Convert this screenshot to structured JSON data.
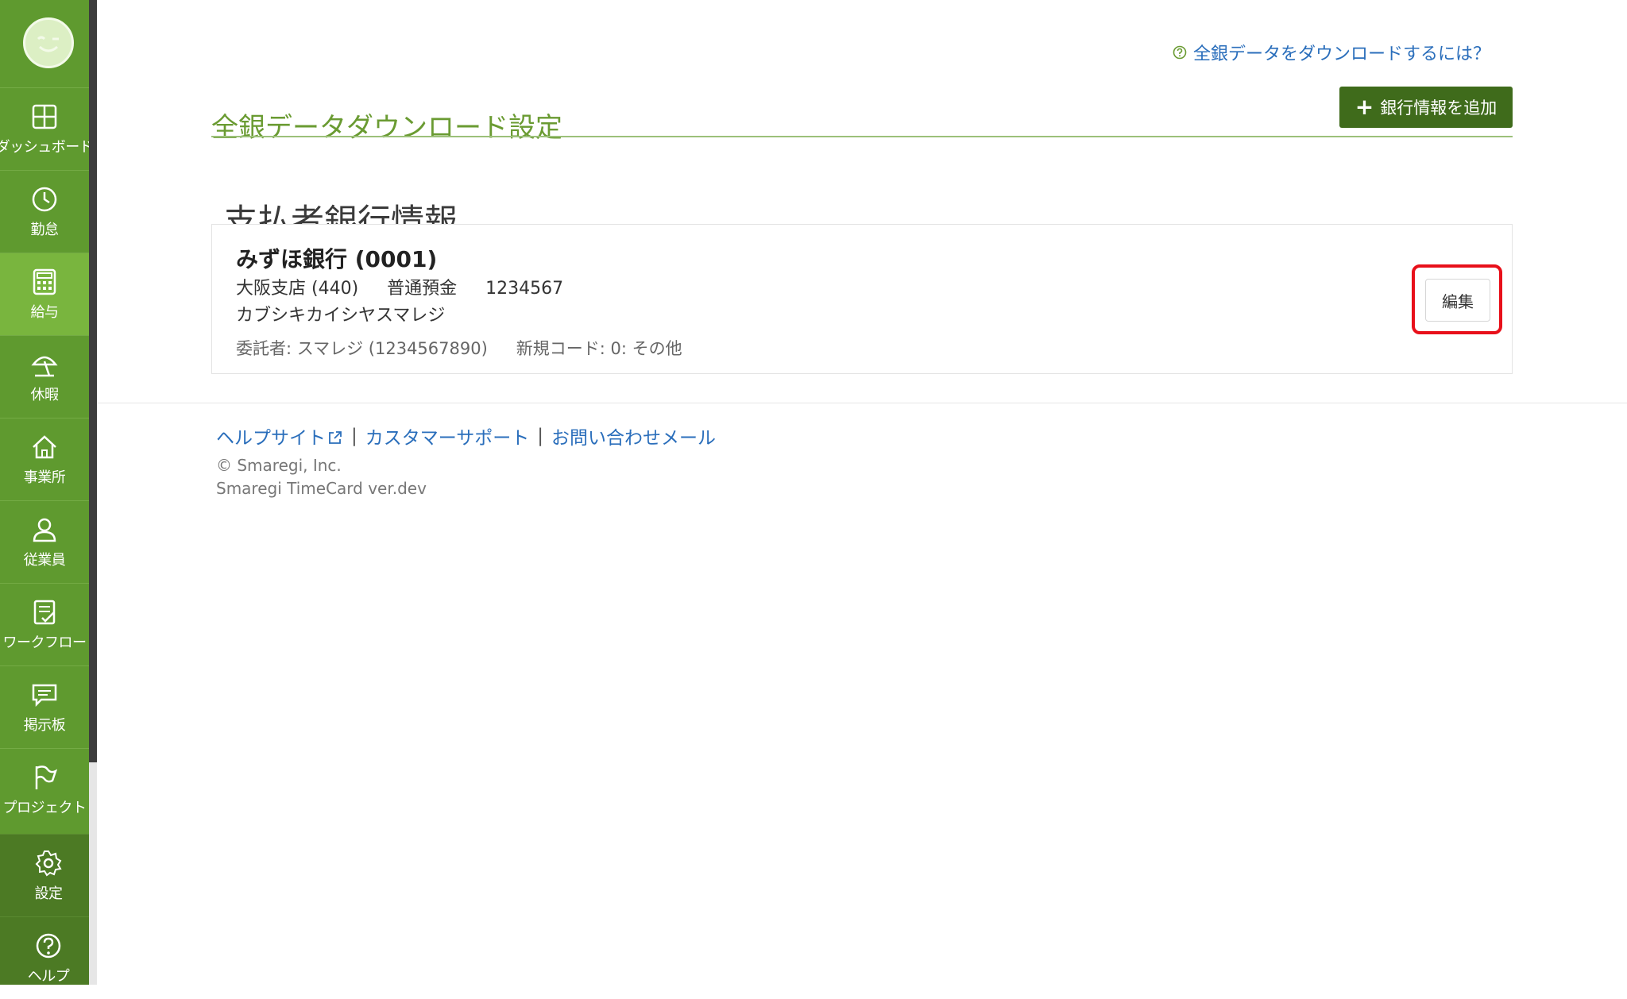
{
  "sidebar": {
    "items": [
      {
        "label": "ダッシュボード",
        "icon": "dashboard-icon"
      },
      {
        "label": "勤怠",
        "icon": "clock-icon"
      },
      {
        "label": "給与",
        "icon": "calculator-icon"
      },
      {
        "label": "休暇",
        "icon": "beach-umbrella-icon"
      },
      {
        "label": "事業所",
        "icon": "home-icon"
      },
      {
        "label": "従業員",
        "icon": "person-icon"
      },
      {
        "label": "ワークフロー",
        "icon": "checklist-icon"
      },
      {
        "label": "掲示板",
        "icon": "chat-icon"
      },
      {
        "label": "プロジェクト",
        "icon": "flag-icon"
      }
    ],
    "bottom_items": [
      {
        "label": "設定",
        "icon": "gear-icon"
      },
      {
        "label": "ヘルプ",
        "icon": "help-icon"
      }
    ],
    "active": "給与"
  },
  "header": {
    "help_link": "全銀データをダウンロードするには？",
    "page_title": "全銀データダウンロード設定",
    "add_button": "銀行情報を追加"
  },
  "section": {
    "title": "支払者銀行情報"
  },
  "bank": {
    "name": "みずほ銀行 (0001)",
    "branch": "大阪支店 (440)",
    "account_type": "普通預金",
    "account_number": "1234567",
    "account_holder": "カブシキカイシヤスマレジ",
    "consignor": "委託者: スマレジ (1234567890)",
    "new_code": "新規コード: 0: その他",
    "edit_button": "編集"
  },
  "footer": {
    "help_site": "ヘルプサイト",
    "sep1": "|",
    "customer_support": "カスタマーサポート",
    "sep2": "|",
    "contact_mail": "お問い合わせメール",
    "copyright": "© Smaregi, Inc.",
    "version": "Smaregi TimeCard ver.dev"
  },
  "colors": {
    "sidebar": "#5f9a2f",
    "sidebar_active": "#79b53e",
    "title_green": "#6a9b32",
    "button_dark_green": "#3f6b1b",
    "link_blue": "#2a6ebb",
    "highlight_red": "#e8101a"
  }
}
